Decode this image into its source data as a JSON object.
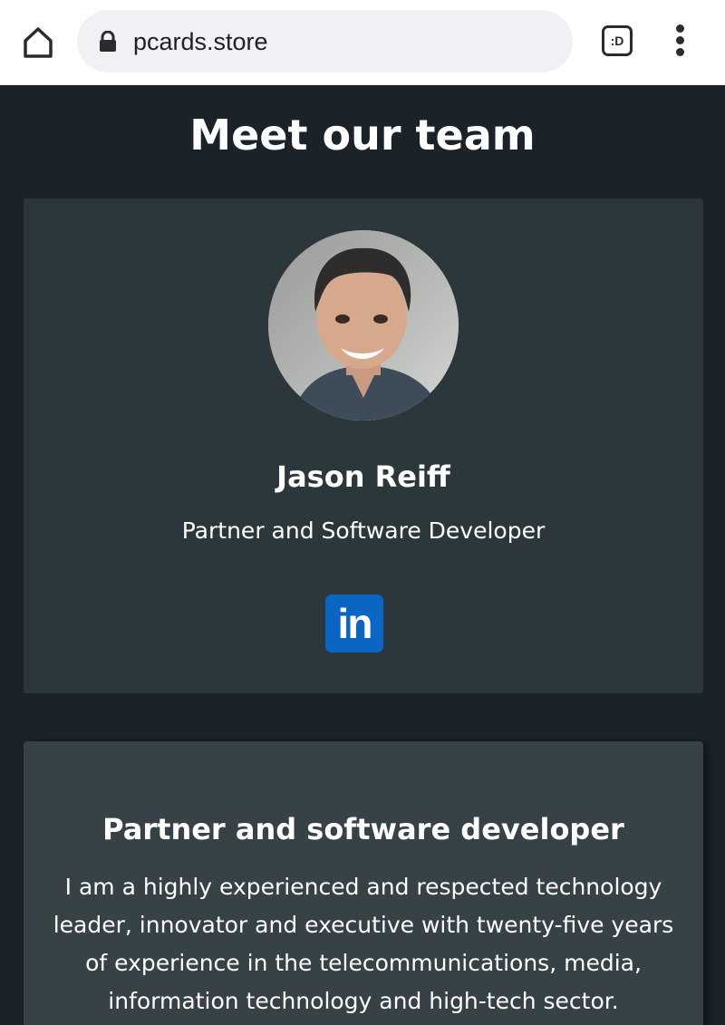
{
  "browser": {
    "url": "pcards.store",
    "tabs_label": ":D",
    "icons": {
      "home": "home-icon",
      "lock": "lock-icon",
      "menu": "more-vert-icon"
    }
  },
  "page": {
    "title": "Meet our team"
  },
  "team_card": {
    "name": "Jason Reiff",
    "role": "Partner and Software Developer",
    "social": {
      "label": "in",
      "icon": "linkedin-icon",
      "color": "#0a66c2"
    }
  },
  "about_card": {
    "heading": "Partner and software developer",
    "bio": "I am a highly experienced and respected technology leader, innovator and executive with twenty-five years of experience in the telecommunications, media, information technology and high-tech sector."
  },
  "colors": {
    "page_background": "#1b2329",
    "card_background": "#2c373b",
    "card2_background": "#374247",
    "text": "#ffffff"
  }
}
